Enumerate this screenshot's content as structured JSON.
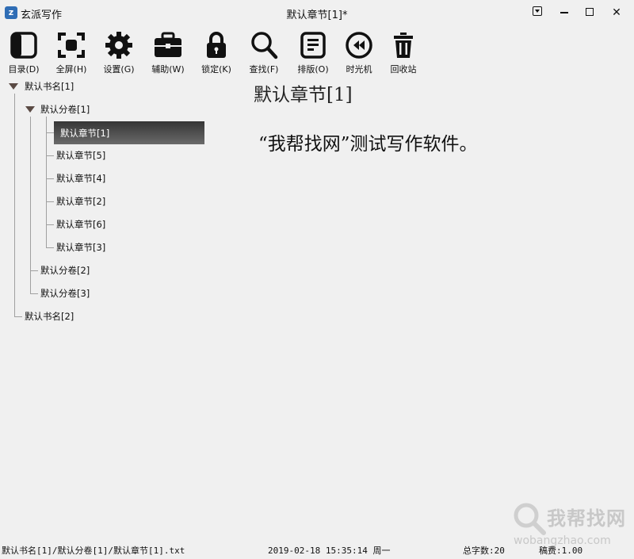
{
  "window": {
    "app_name": "玄派写作",
    "title": "默认章节[1]*",
    "close_glyph": "✕"
  },
  "toolbar": {
    "items": [
      {
        "label": "目录(D)",
        "icon": "sidebar-panel-icon"
      },
      {
        "label": "全屏(H)",
        "icon": "fullscreen-icon"
      },
      {
        "label": "设置(G)",
        "icon": "gear-icon"
      },
      {
        "label": "辅助(W)",
        "icon": "toolbox-icon"
      },
      {
        "label": "锁定(K)",
        "icon": "lock-icon"
      },
      {
        "label": "查找(F)",
        "icon": "search-icon"
      },
      {
        "label": "排版(O)",
        "icon": "format-document-icon"
      },
      {
        "label": "时光机",
        "icon": "rewind-icon"
      },
      {
        "label": "回收站",
        "icon": "trash-icon"
      }
    ]
  },
  "tree": {
    "book1": "默认书名[1]",
    "volume1": "默认分卷[1]",
    "chapters": [
      "默认章节[1]",
      "默认章节[5]",
      "默认章节[4]",
      "默认章节[2]",
      "默认章节[6]",
      "默认章节[3]"
    ],
    "volume2": "默认分卷[2]",
    "volume3": "默认分卷[3]",
    "book2": "默认书名[2]"
  },
  "editor": {
    "chapter_title": "默认章节[1]",
    "body": "“我帮找网”测试写作软件。"
  },
  "watermark": {
    "text": "我帮找网",
    "url": "wobangzhao.com"
  },
  "status": {
    "path": "默认书名[1]/默认分卷[1]/默认章节[1].txt",
    "datetime": "2019-02-18 15:35:14 周一",
    "word_count": "总字数:20",
    "fee": "稿费:1.00"
  }
}
